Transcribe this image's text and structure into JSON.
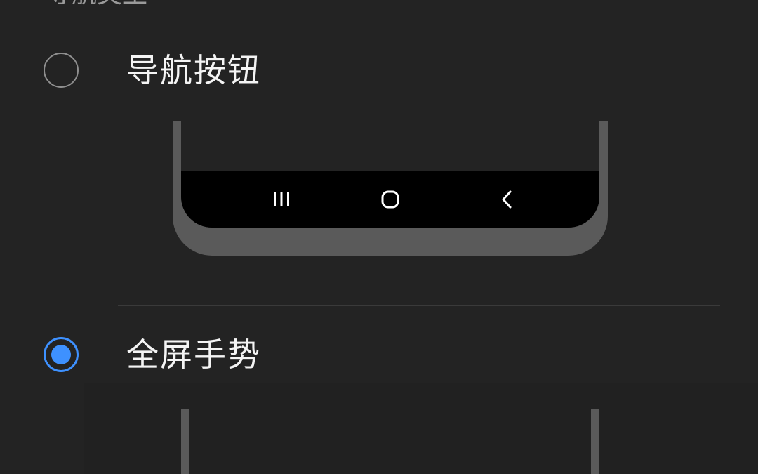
{
  "header": {
    "section_title": "导航类型"
  },
  "options": [
    {
      "label": "导航按钮",
      "selected": false,
      "icon": "radio-unselected-icon"
    },
    {
      "label": "全屏手势",
      "selected": true,
      "icon": "radio-selected-icon"
    }
  ],
  "nav_bar_preview": {
    "icons": [
      "recent-apps-icon",
      "home-icon",
      "back-icon"
    ]
  },
  "colors": {
    "background": "#232323",
    "accent": "#3e91ff",
    "phone_frame": "#5a5a5a",
    "nav_bar": "#000000"
  }
}
